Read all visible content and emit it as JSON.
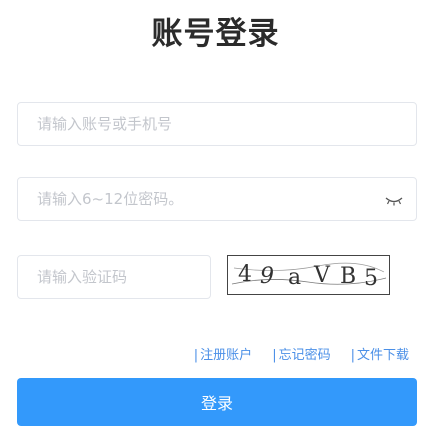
{
  "title": "账号登录",
  "username": {
    "value": "",
    "placeholder": "请输入账号或手机号"
  },
  "password": {
    "value": "",
    "placeholder": "请输入6~12位密码。"
  },
  "captcha_input": {
    "value": "",
    "placeholder": "请输入验证码"
  },
  "captcha_image": {
    "chars": [
      "4",
      "9",
      "a",
      "V",
      "B",
      "5"
    ]
  },
  "links": [
    {
      "label": "注册账户"
    },
    {
      "label": "忘记密码"
    },
    {
      "label": "文件下载"
    }
  ],
  "login_button": {
    "label": "登录"
  },
  "colors": {
    "accent": "#3399fb",
    "link": "#4a8fe7",
    "title": "#2b2b2b"
  },
  "icons": {
    "password_toggle": "eye-closed-icon"
  }
}
